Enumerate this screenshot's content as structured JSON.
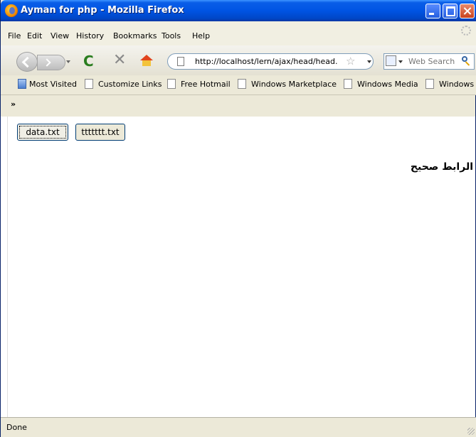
{
  "window": {
    "title": "Ayman for php - Mozilla Firefox"
  },
  "menu": {
    "items": [
      "File",
      "Edit",
      "View",
      "History",
      "Bookmarks",
      "Tools",
      "Help"
    ]
  },
  "navigation": {
    "url": "http://localhost/lern/ajax/head/head.",
    "search_placeholder": "Web Search"
  },
  "bookmarks": {
    "items": [
      "Most Visited",
      "Customize Links",
      "Free Hotmail",
      "Windows Marketplace",
      "Windows Media",
      "Windows"
    ],
    "overflow_chevron": "»"
  },
  "page": {
    "buttons": [
      "data.txt",
      "ttttttt.txt"
    ],
    "message": "الرابط صحيح"
  },
  "status": {
    "text": "Done"
  }
}
